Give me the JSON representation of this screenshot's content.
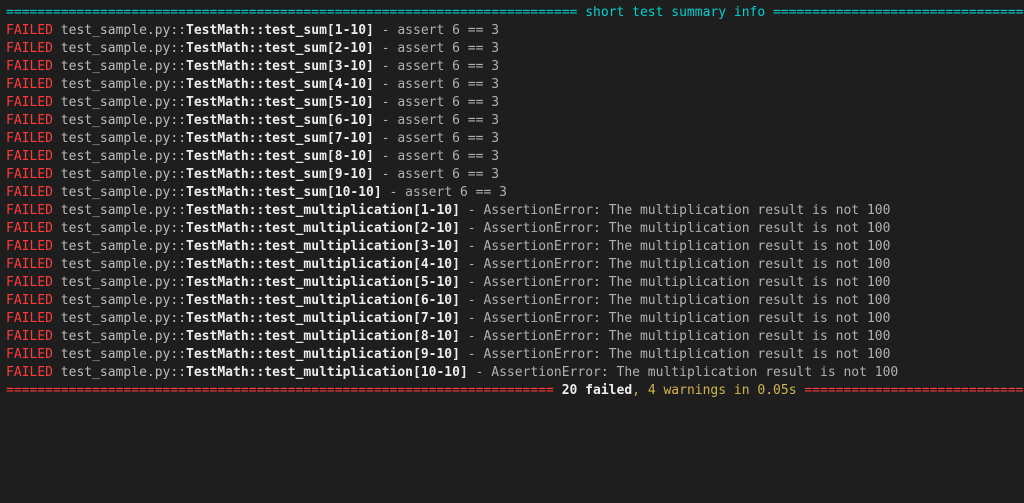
{
  "header": {
    "title": "short test summary info",
    "left_rule": "=========================================================================",
    "right_rule": "========================================"
  },
  "failed_label": "FAILED",
  "sum_tests": [
    {
      "path": "test_sample.py::",
      "bold": "TestMath::test_sum[1-10]",
      "tail": " - assert 6 == 3"
    },
    {
      "path": "test_sample.py::",
      "bold": "TestMath::test_sum[2-10]",
      "tail": " - assert 6 == 3"
    },
    {
      "path": "test_sample.py::",
      "bold": "TestMath::test_sum[3-10]",
      "tail": " - assert 6 == 3"
    },
    {
      "path": "test_sample.py::",
      "bold": "TestMath::test_sum[4-10]",
      "tail": " - assert 6 == 3"
    },
    {
      "path": "test_sample.py::",
      "bold": "TestMath::test_sum[5-10]",
      "tail": " - assert 6 == 3"
    },
    {
      "path": "test_sample.py::",
      "bold": "TestMath::test_sum[6-10]",
      "tail": " - assert 6 == 3"
    },
    {
      "path": "test_sample.py::",
      "bold": "TestMath::test_sum[7-10]",
      "tail": " - assert 6 == 3"
    },
    {
      "path": "test_sample.py::",
      "bold": "TestMath::test_sum[8-10]",
      "tail": " - assert 6 == 3"
    },
    {
      "path": "test_sample.py::",
      "bold": "TestMath::test_sum[9-10]",
      "tail": " - assert 6 == 3"
    },
    {
      "path": "test_sample.py::",
      "bold": "TestMath::test_sum[10-10]",
      "tail": " - assert 6 == 3"
    }
  ],
  "mult_tests": [
    {
      "path": "test_sample.py::",
      "bold": "TestMath::test_multiplication[1-10]",
      "tail": " - AssertionError: The multiplication result is not 100"
    },
    {
      "path": "test_sample.py::",
      "bold": "TestMath::test_multiplication[2-10]",
      "tail": " - AssertionError: The multiplication result is not 100"
    },
    {
      "path": "test_sample.py::",
      "bold": "TestMath::test_multiplication[3-10]",
      "tail": " - AssertionError: The multiplication result is not 100"
    },
    {
      "path": "test_sample.py::",
      "bold": "TestMath::test_multiplication[4-10]",
      "tail": " - AssertionError: The multiplication result is not 100"
    },
    {
      "path": "test_sample.py::",
      "bold": "TestMath::test_multiplication[5-10]",
      "tail": " - AssertionError: The multiplication result is not 100"
    },
    {
      "path": "test_sample.py::",
      "bold": "TestMath::test_multiplication[6-10]",
      "tail": " - AssertionError: The multiplication result is not 100"
    },
    {
      "path": "test_sample.py::",
      "bold": "TestMath::test_multiplication[7-10]",
      "tail": " - AssertionError: The multiplication result is not 100"
    },
    {
      "path": "test_sample.py::",
      "bold": "TestMath::test_multiplication[8-10]",
      "tail": " - AssertionError: The multiplication result is not 100"
    },
    {
      "path": "test_sample.py::",
      "bold": "TestMath::test_multiplication[9-10]",
      "tail": " - AssertionError: The multiplication result is not 100"
    },
    {
      "path": "test_sample.py::",
      "bold": "TestMath::test_multiplication[10-10]",
      "tail": " - AssertionError: The multiplication result is not 100"
    }
  ],
  "footer": {
    "left_rule": "======================================================================",
    "failed_text": " 20 failed",
    "comma": ", ",
    "warnings_text": "4 warnings in 0.05s",
    "right_rule": " ===================================================================="
  }
}
